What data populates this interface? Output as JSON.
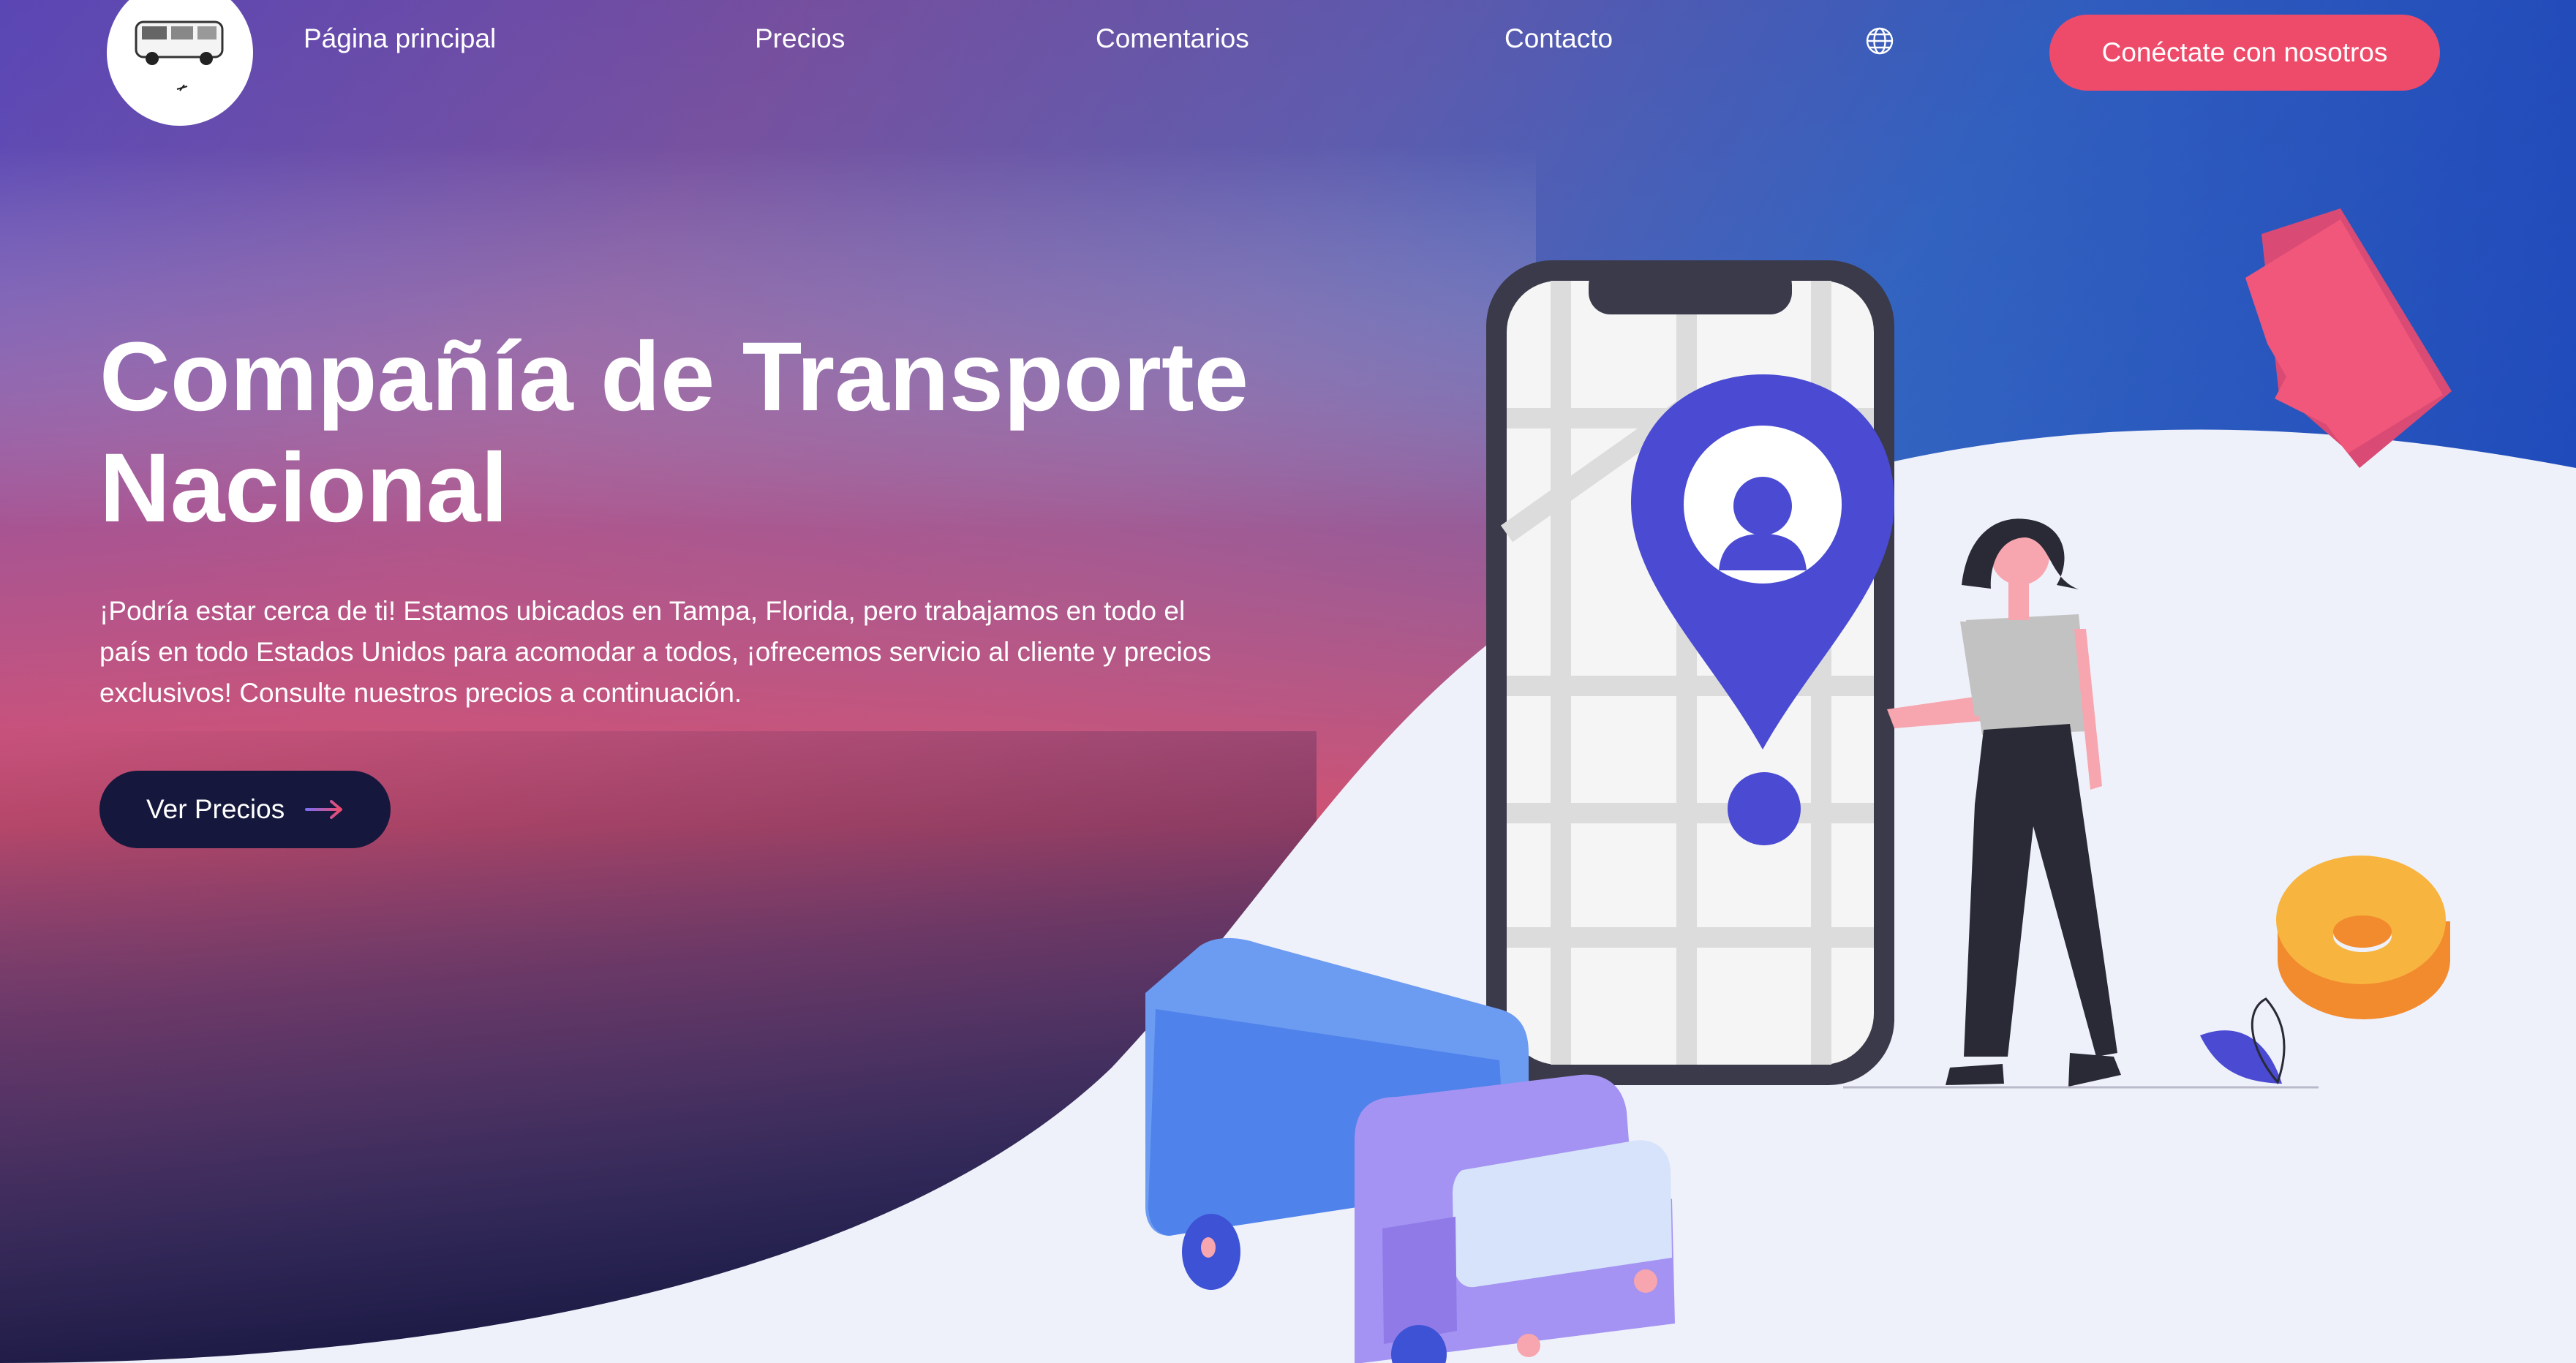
{
  "nav": {
    "logo_alt": "logo",
    "links": [
      "Página principal",
      "Precios",
      "Comentarios",
      "Contacto"
    ],
    "language_icon": "globe-icon",
    "cta": "Conéctate con nosotros"
  },
  "hero": {
    "title": "Compañía de Transporte Nacional",
    "description": "¡Podría estar cerca de ti! Estamos ubicados en Tampa, Florida, pero trabajamos en todo el país en todo Estados Unidos para acomodar a todos, ¡ofrecemos servicio al cliente y precios exclusivos! Consulte nuestros precios a continuación.",
    "button": "Ver Precios",
    "button_icon": "arrow-right-icon"
  },
  "colors": {
    "accent": "#ee4b6a",
    "dark_button": "#15173d",
    "pin": "#4a4ad3",
    "gradient_purple": "#8048b0",
    "gradient_blue": "#1f4fc0"
  }
}
